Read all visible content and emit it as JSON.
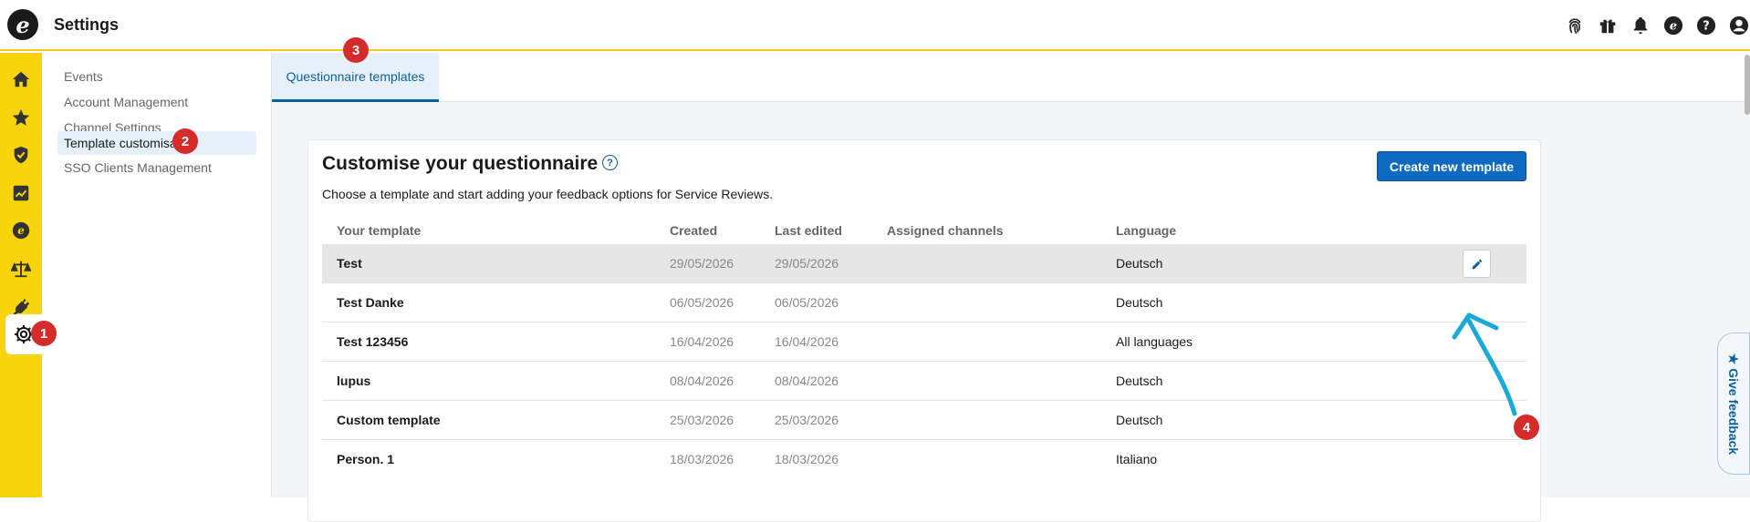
{
  "header": {
    "logo_letter": "e",
    "title": "Settings",
    "icons": [
      "fingerprint-icon",
      "gift-icon",
      "bell-icon",
      "brand-e-icon",
      "help-icon",
      "user-icon"
    ]
  },
  "rail": {
    "items": [
      "home-icon",
      "star-icon",
      "shield-check-icon",
      "chart-icon",
      "brand-e-icon",
      "scales-icon",
      "plug-icon",
      "gear-icon"
    ],
    "active": "gear-icon"
  },
  "sidebar": {
    "items": [
      {
        "label": "Events"
      },
      {
        "label": "Account Management"
      },
      {
        "label": "Channel Settings"
      },
      {
        "label": "Template customisation"
      },
      {
        "label": "SSO Clients Management"
      }
    ],
    "selected_index": 3
  },
  "tabs": [
    {
      "label": "Questionnaire templates"
    }
  ],
  "card": {
    "title": "Customise your questionnaire",
    "help_glyph": "?",
    "description": "Choose a template and start adding your feedback options for Service Reviews.",
    "create_button": "Create new template"
  },
  "table": {
    "headers": {
      "template": "Your template",
      "created": "Created",
      "edited": "Last edited",
      "channels": "Assigned channels",
      "language": "Language"
    },
    "rows": [
      {
        "name": "Test",
        "created": "29/05/2026",
        "edited": "29/05/2026",
        "channels": "",
        "language": "Deutsch"
      },
      {
        "name": "Test Danke",
        "created": "06/05/2026",
        "edited": "06/05/2026",
        "channels": "",
        "language": "Deutsch"
      },
      {
        "name": "Test 123456",
        "created": "16/04/2026",
        "edited": "16/04/2026",
        "channels": "",
        "language": "All languages"
      },
      {
        "name": "lupus",
        "created": "08/04/2026",
        "edited": "08/04/2026",
        "channels": "",
        "language": "Deutsch"
      },
      {
        "name": "Custom template",
        "created": "25/03/2026",
        "edited": "25/03/2026",
        "channels": "",
        "language": "Deutsch"
      },
      {
        "name": "Person. 1",
        "created": "18/03/2026",
        "edited": "18/03/2026",
        "channels": "",
        "language": "Italiano"
      }
    ]
  },
  "annotations": {
    "badges": [
      "1",
      "2",
      "3",
      "4"
    ],
    "badge_color": "#d42b2b",
    "arrow_color": "#1ba9d6"
  },
  "feedback": {
    "label": "★ Give feedback"
  },
  "colors": {
    "brand_yellow": "#f7d40c",
    "accent_blue": "#0e6ac1"
  }
}
